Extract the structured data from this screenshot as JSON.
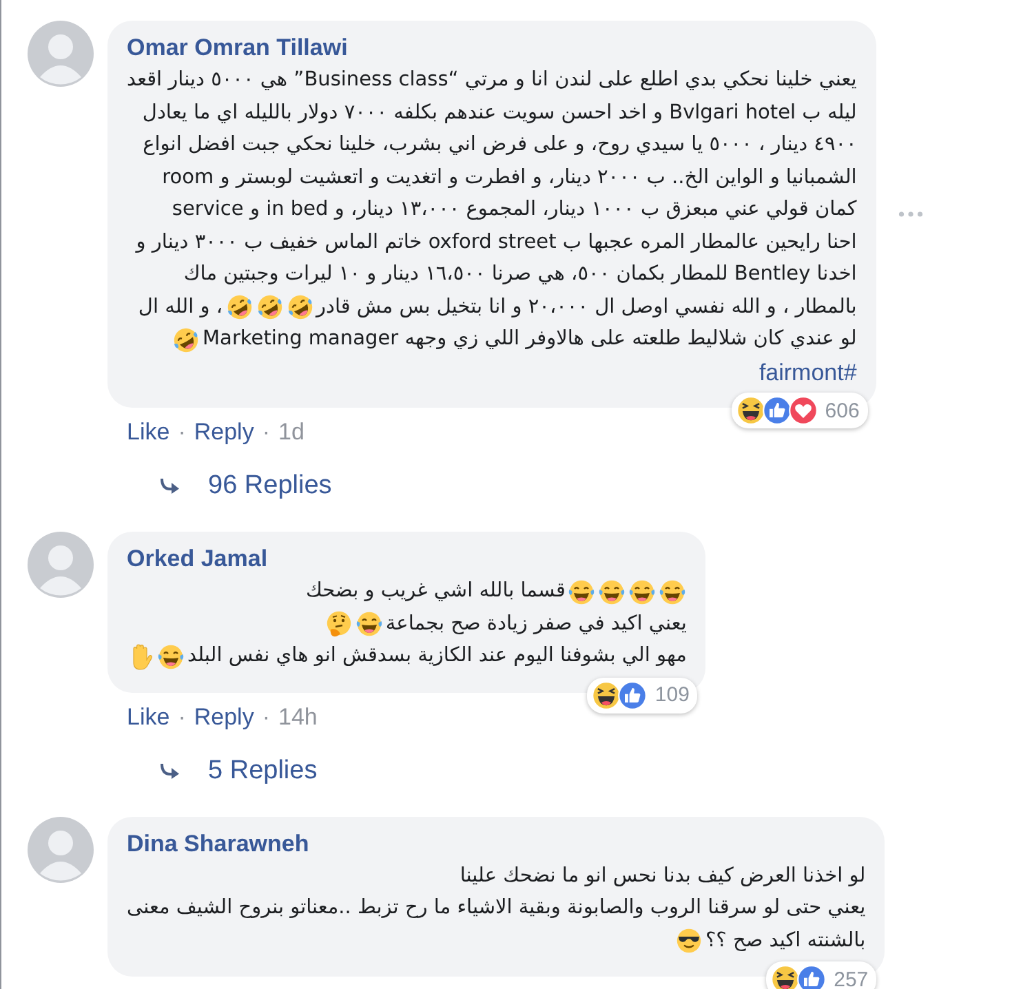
{
  "comments": [
    {
      "author": "Omar Omran Tillawi",
      "menu": true,
      "lines": [
        {
          "parts": [
            {
              "kind": "text",
              "text": "يعني خلينا نحكي بدي اطلع على لندن انا و مرتي “Business class” هي ٥٠٠٠ دينار اقعد"
            }
          ]
        },
        {
          "parts": [
            {
              "kind": "text",
              "text": "ليله ب Bvlgari hotel و اخد احسن سويت عندهم بكلفه ٧٠٠٠ دولار بالليله اي ما يعادل"
            }
          ]
        },
        {
          "parts": [
            {
              "kind": "text",
              "text": "٤٩٠٠ دينار ، ٥٠٠٠ يا سيدي روح، و على فرض اني بشرب، خلينا نحكي جبت افضل انواع"
            }
          ]
        },
        {
          "parts": [
            {
              "kind": "text",
              "text": "الشمبانيا و الواين الخ.. ب ٢٠٠٠ دينار، و افطرت و اتغديت و اتعشيت لوبستر و room"
            }
          ]
        },
        {
          "parts": [
            {
              "kind": "text",
              "text": "service و in bed كمان قولي عني مبعزق ب ١٠٠٠ دينار، المجموع ١٣،٠٠٠ دينار، و"
            }
          ]
        },
        {
          "parts": [
            {
              "kind": "text",
              "text": "احنا رايحين عالمطار المره عجبها ب oxford street خاتم الماس خفيف ب ٣٠٠٠ دينار و"
            }
          ]
        },
        {
          "parts": [
            {
              "kind": "text",
              "text": "اخدنا Bentley للمطار بكمان ٥٠٠، هي صرنا ١٦،٥٠٠ دينار و ١٠ ليرات وجبتين ماك"
            }
          ]
        },
        {
          "parts": [
            {
              "kind": "text",
              "text": "بالمطار ، و الله نفسي اوصل ال ٢٠،٠٠٠ و انا بتخيل بس مش قادر"
            },
            {
              "kind": "emoji_rofl"
            },
            {
              "kind": "emoji_rofl"
            },
            {
              "kind": "emoji_rofl"
            },
            {
              "kind": "text",
              "text": "، و الله ال"
            }
          ]
        },
        {
          "parts": [
            {
              "kind": "text",
              "text": "Marketing manager لو عندي كان شلاليط طلعته على هالاوفر اللي زي وجهه"
            },
            {
              "kind": "emoji_rofl"
            }
          ]
        },
        {
          "parts": [
            {
              "kind": "link",
              "text": "#fairmont"
            }
          ]
        }
      ],
      "reactions": [
        {
          "kind": "haha"
        },
        {
          "kind": "like"
        },
        {
          "kind": "love"
        }
      ],
      "reaction_count": "606",
      "actions": {
        "like": "Like",
        "separator_after_like": "·",
        "reply": "Reply",
        "separator_after_reply": "·",
        "time": "1d"
      },
      "replies": "96 Replies"
    },
    {
      "author": "Orked Jamal",
      "menu": false,
      "lines": [
        {
          "parts": [
            {
              "kind": "emoji_tears"
            },
            {
              "kind": "emoji_tears"
            },
            {
              "kind": "emoji_tears"
            },
            {
              "kind": "emoji_tears"
            },
            {
              "kind": "text",
              "text": "قسما بالله اشي غريب و بضحك"
            }
          ]
        },
        {
          "parts": [
            {
              "kind": "text",
              "text": "يعني اكيد في صفر زيادة صح بجماعة"
            },
            {
              "kind": "emoji_tears"
            },
            {
              "kind": "emoji_thinking"
            }
          ]
        },
        {
          "parts": [
            {
              "kind": "text",
              "text": "مهو الي بشوفنا اليوم عند الكازية بسدقش انو هاي نفس البلد"
            },
            {
              "kind": "emoji_tears"
            },
            {
              "kind": "emoji_hand"
            }
          ]
        }
      ],
      "reactions": [
        {
          "kind": "haha"
        },
        {
          "kind": "like"
        }
      ],
      "reaction_count": "109",
      "actions": {
        "like": "Like",
        "separator_after_like": "·",
        "reply": "Reply",
        "separator_after_reply": "·",
        "time": "14h"
      },
      "replies": "5 Replies"
    },
    {
      "author": "Dina Sharawneh",
      "menu": false,
      "lines": [
        {
          "parts": [
            {
              "kind": "text",
              "text": "لو اخذنا العرض كيف بدنا نحس انو ما نضحك علينا"
            }
          ]
        },
        {
          "parts": [
            {
              "kind": "text",
              "text": "يعني حتى لو سرقنا الروب والصابونة وبقية الاشياء ما رح تزبط ..معناتو بنروح الشيف معنى"
            }
          ]
        },
        {
          "parts": [
            {
              "kind": "text",
              "text": "بالشنته اكيد صح ؟؟"
            },
            {
              "kind": "emoji_sunglasses"
            }
          ]
        }
      ],
      "reactions": [
        {
          "kind": "haha"
        },
        {
          "kind": "like"
        }
      ],
      "reaction_count": "257"
    }
  ]
}
